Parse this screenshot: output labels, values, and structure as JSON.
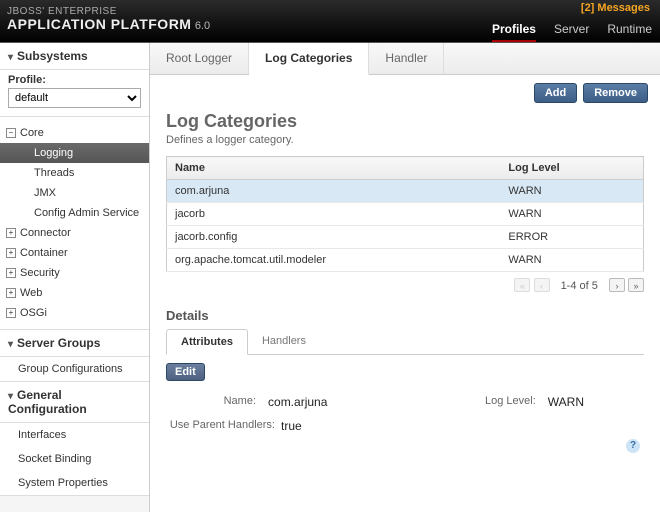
{
  "header": {
    "messages_label": "[2] Messages",
    "brand_line1": "JBOSS' ENTERPRISE",
    "brand_line2": "APPLICATION PLATFORM",
    "brand_version": "6.0",
    "nav": [
      {
        "label": "Profiles",
        "active": true
      },
      {
        "label": "Server",
        "active": false
      },
      {
        "label": "Runtime",
        "active": false
      }
    ]
  },
  "sidebar": {
    "subsystems_label": "Subsystems",
    "profile_label": "Profile:",
    "profile_value": "default",
    "tree": [
      {
        "label": "Core",
        "expanded": true,
        "children": [
          {
            "label": "Logging",
            "selected": true
          },
          {
            "label": "Threads"
          },
          {
            "label": "JMX"
          },
          {
            "label": "Config Admin Service"
          }
        ]
      },
      {
        "label": "Connector",
        "expanded": false
      },
      {
        "label": "Container",
        "expanded": false
      },
      {
        "label": "Security",
        "expanded": false
      },
      {
        "label": "Web",
        "expanded": false
      },
      {
        "label": "OSGi",
        "expanded": false
      }
    ],
    "server_groups_label": "Server Groups",
    "server_groups_items": [
      "Group Configurations"
    ],
    "general_config_label": "General Configuration",
    "general_config_items": [
      "Interfaces",
      "Socket Binding",
      "System Properties"
    ]
  },
  "main": {
    "tabs": [
      {
        "label": "Root Logger"
      },
      {
        "label": "Log Categories",
        "active": true
      },
      {
        "label": "Handler"
      }
    ],
    "toolbar": {
      "add_label": "Add",
      "remove_label": "Remove"
    },
    "title": "Log Categories",
    "subtitle": "Defines a logger category.",
    "table": {
      "columns": [
        "Name",
        "Log Level"
      ],
      "rows": [
        {
          "name": "com.arjuna",
          "level": "WARN",
          "selected": true
        },
        {
          "name": "jacorb",
          "level": "WARN"
        },
        {
          "name": "jacorb.config",
          "level": "ERROR"
        },
        {
          "name": "org.apache.tomcat.util.modeler",
          "level": "WARN"
        }
      ]
    },
    "pager": {
      "text": "1-4 of 5"
    },
    "details_label": "Details",
    "subtabs": [
      {
        "label": "Attributes",
        "active": true
      },
      {
        "label": "Handlers"
      }
    ],
    "edit_label": "Edit",
    "form": {
      "name_label": "Name:",
      "name_value": "com.arjuna",
      "loglevel_label": "Log Level:",
      "loglevel_value": "WARN",
      "useparent_label": "Use Parent Handlers:",
      "useparent_value": "true"
    }
  }
}
